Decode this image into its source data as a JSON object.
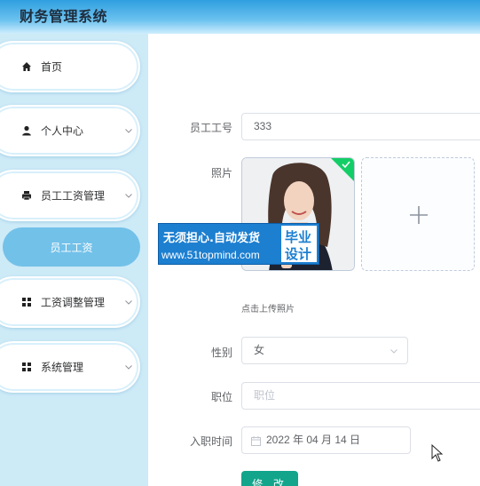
{
  "app": {
    "title": "财务管理系统"
  },
  "sidebar": {
    "items": [
      {
        "label": "首页",
        "icon": "home-icon"
      },
      {
        "label": "个人中心",
        "icon": "user-icon",
        "expandable": true
      },
      {
        "label": "员工工资管理",
        "icon": "printer-icon",
        "expandable": true
      },
      {
        "label": "工资调整管理",
        "icon": "grid-icon",
        "expandable": true
      },
      {
        "label": "系统管理",
        "icon": "grid-icon",
        "expandable": true
      }
    ],
    "active_sub_item": {
      "label": "员工工资"
    }
  },
  "form": {
    "employee_id": {
      "label": "员工工号",
      "value": "333"
    },
    "photo": {
      "label": "照片",
      "hint": "点击上传照片",
      "upload_icon": "plus-icon"
    },
    "gender": {
      "label": "性别",
      "value": "女"
    },
    "position": {
      "label": "职位",
      "placeholder": "职位"
    },
    "hire_date": {
      "label": "入职时间",
      "value": "2022 年 04 月 14 日"
    },
    "submit_label": "修 改"
  },
  "watermark": {
    "line1": "无须担心.自动发货",
    "line2": "www.51topmind.com",
    "badge_line1": "毕业",
    "badge_line2": "设计"
  },
  "colors": {
    "topbar": "#2f9fe0",
    "sidebar_bg": "#cdeaf7",
    "active_item": "#72c1e9",
    "submit_button": "#12a58c",
    "success_check": "#13ce66"
  }
}
